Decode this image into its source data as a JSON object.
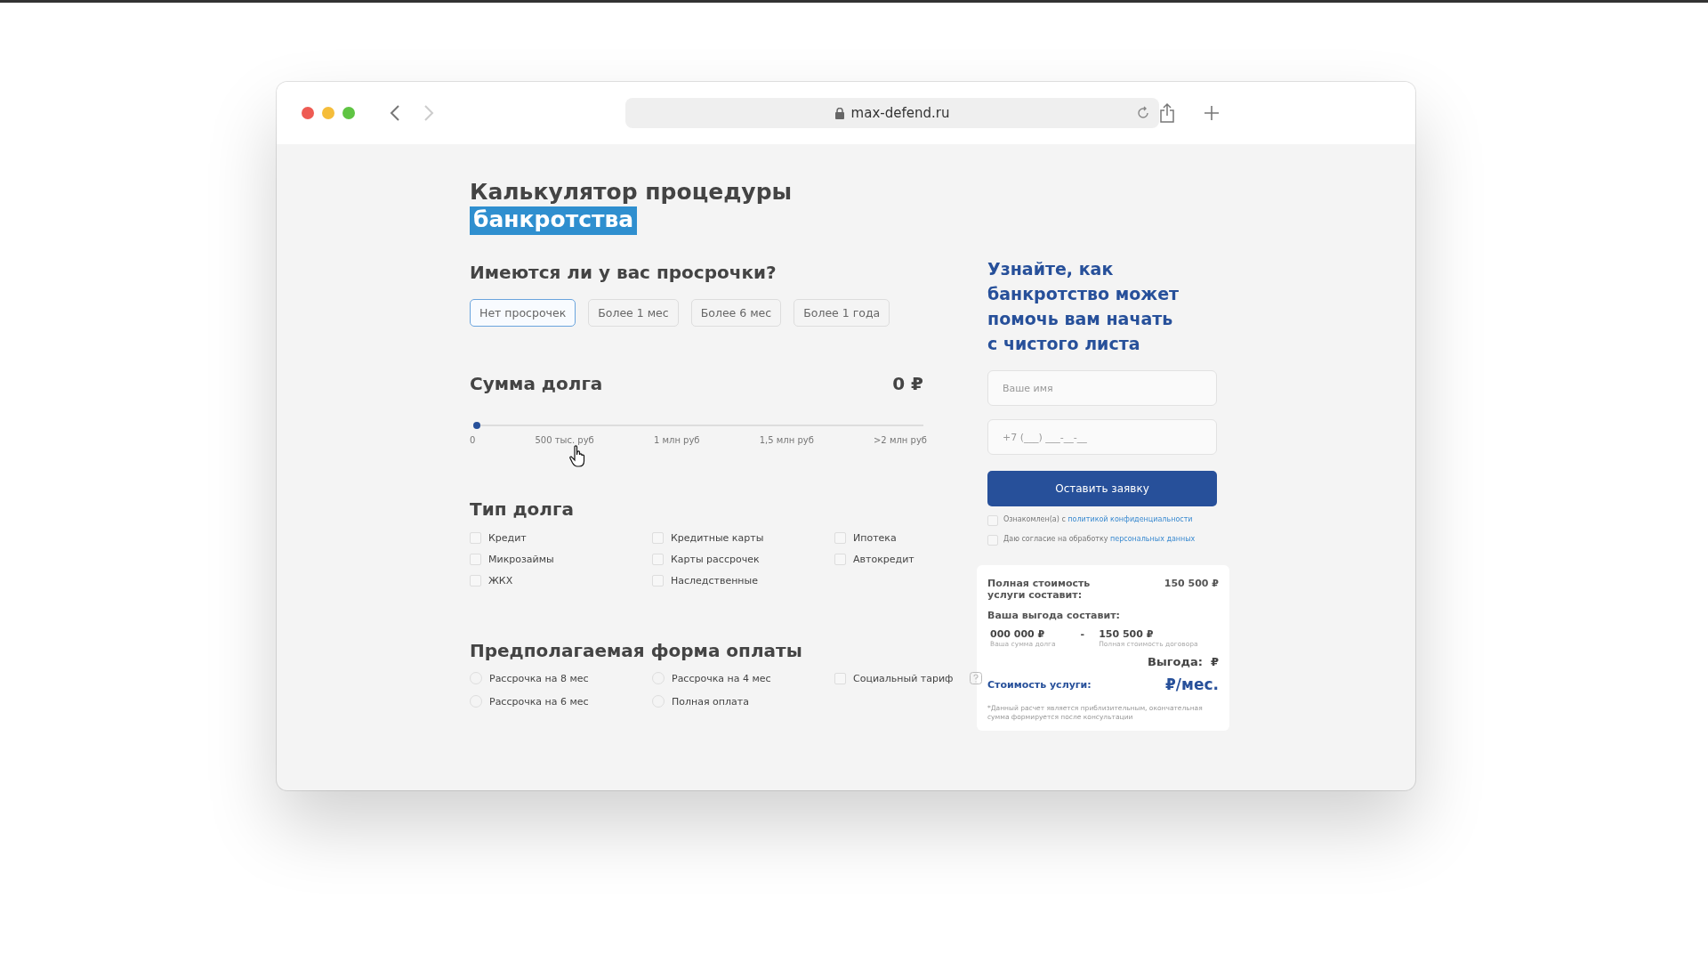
{
  "browser": {
    "url": "max-defend.ru"
  },
  "calculator": {
    "title": "Калькулятор процедуры",
    "title_highlight": "банкротства",
    "overdue": {
      "question": "Имеются ли у вас просрочки?",
      "options": [
        {
          "label": "Нет просрочек",
          "selected": true
        },
        {
          "label": "Более 1 мес",
          "selected": false
        },
        {
          "label": "Более 6 мес",
          "selected": false
        },
        {
          "label": "Более 1 года",
          "selected": false
        }
      ]
    },
    "debt_sum": {
      "title": "Сумма долга",
      "amount": "0 ₽",
      "level": 0,
      "ticks": [
        "0",
        "500 тыс. руб",
        "1 млн руб",
        "1,5 млн руб",
        ">2 млн руб"
      ]
    },
    "debt_types": {
      "title": "Тип долга",
      "items": [
        {
          "label": "Кредит",
          "checked": false
        },
        {
          "label": "Кредитные карты",
          "checked": false
        },
        {
          "label": "Ипотека",
          "checked": false
        },
        {
          "label": "Микрозаймы",
          "checked": false
        },
        {
          "label": "Карты рассрочек",
          "checked": false
        },
        {
          "label": "Автокредит",
          "checked": false
        },
        {
          "label": "ЖКХ",
          "checked": false
        },
        {
          "label": "Наследственные",
          "checked": false
        }
      ]
    },
    "payment": {
      "title": "Предполагаемая форма оплаты",
      "columns": [
        [
          {
            "kind": "radio",
            "label": "Рассрочка на 8 мес",
            "selected": false
          },
          {
            "kind": "radio",
            "label": "Рассрочка на 6 мес",
            "selected": false
          }
        ],
        [
          {
            "kind": "radio",
            "label": "Рассрочка на 4 мес",
            "selected": false
          },
          {
            "kind": "radio",
            "label": "Полная оплата",
            "selected": false
          }
        ],
        [
          {
            "kind": "checkbox",
            "label": "Социальный тариф",
            "checked": false
          }
        ]
      ]
    }
  },
  "lead_form": {
    "heading": [
      "Узнайте, как",
      "банкротство может",
      "помочь вам начать",
      "с чистого листа"
    ],
    "name_field": {
      "placeholder": "Ваше имя"
    },
    "phone_field": {
      "placeholder": "+7 (___) ___-__-__"
    },
    "submit": "Оставить заявку",
    "consents": [
      {
        "text": "Ознакомлен(а) с ",
        "link": "политикой конфиденциальности",
        "checked": false
      },
      {
        "text": "Даю согласие на обработку ",
        "link": "персональных данных",
        "checked": false
      }
    ]
  },
  "summary": {
    "total_label": "Полная стоимость услуги составит:",
    "total_value": "150 500 ₽",
    "benefit_label": "Ваша выгода составит:",
    "debt_value": "000 000 ₽",
    "debt_caption": "Ваша сумма долга",
    "minus": "-",
    "contract_value": "150 500 ₽",
    "contract_caption": "Полная стоимость договора",
    "benefit_result": "Выгода:  ₽",
    "service_label": "Стоимость услуги:",
    "service_value": "₽/мес.",
    "note": "*Данный расчет является приблизительным, окончательная сумма формируется после консультации"
  }
}
